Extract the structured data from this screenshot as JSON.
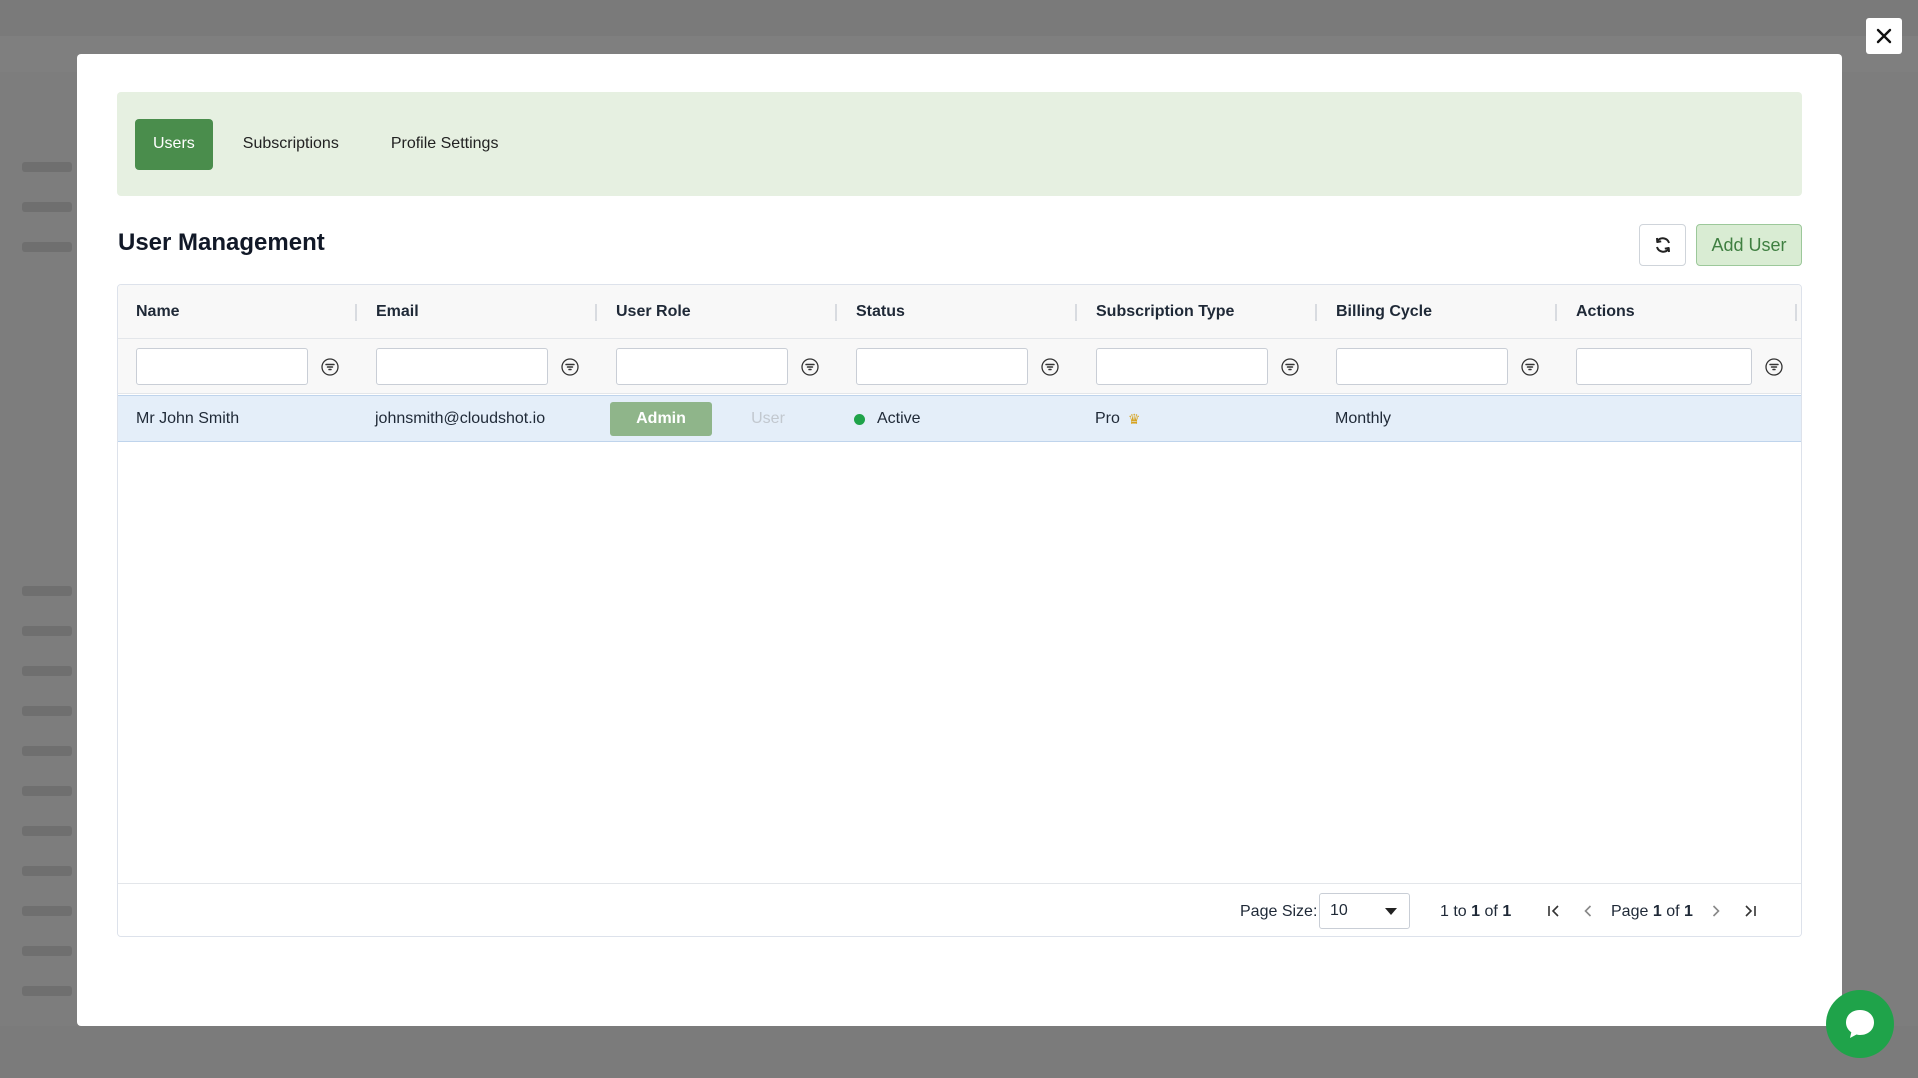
{
  "tabs": [
    {
      "label": "Users",
      "active": true
    },
    {
      "label": "Subscriptions",
      "active": false
    },
    {
      "label": "Profile Settings",
      "active": false
    }
  ],
  "section_title": "User Management",
  "add_user_label": "Add User",
  "columns": [
    "Name",
    "Email",
    "User Role",
    "Status",
    "Subscription Type",
    "Billing Cycle",
    "Actions"
  ],
  "rows": [
    {
      "name": "Mr John Smith",
      "email": "johnsmith@cloudshot.io",
      "role_admin": "Admin",
      "role_user": "User",
      "selected_role": "Admin",
      "status": "Active",
      "subscription": "Pro",
      "billing": "Monthly",
      "actions": ""
    }
  ],
  "pagination": {
    "page_size_label": "Page Size:",
    "page_size": "10",
    "range_from": "1",
    "range_to_word": "to",
    "range_to": "1",
    "of_word": "of",
    "total": "1",
    "page_word": "Page",
    "current_page": "1",
    "total_pages": "1"
  },
  "colors": {
    "accent": "#4a8d4c",
    "tabbar_bg": "#e6f0e1",
    "status_active": "#1fa34a",
    "selected_row": "#e4eef9"
  }
}
